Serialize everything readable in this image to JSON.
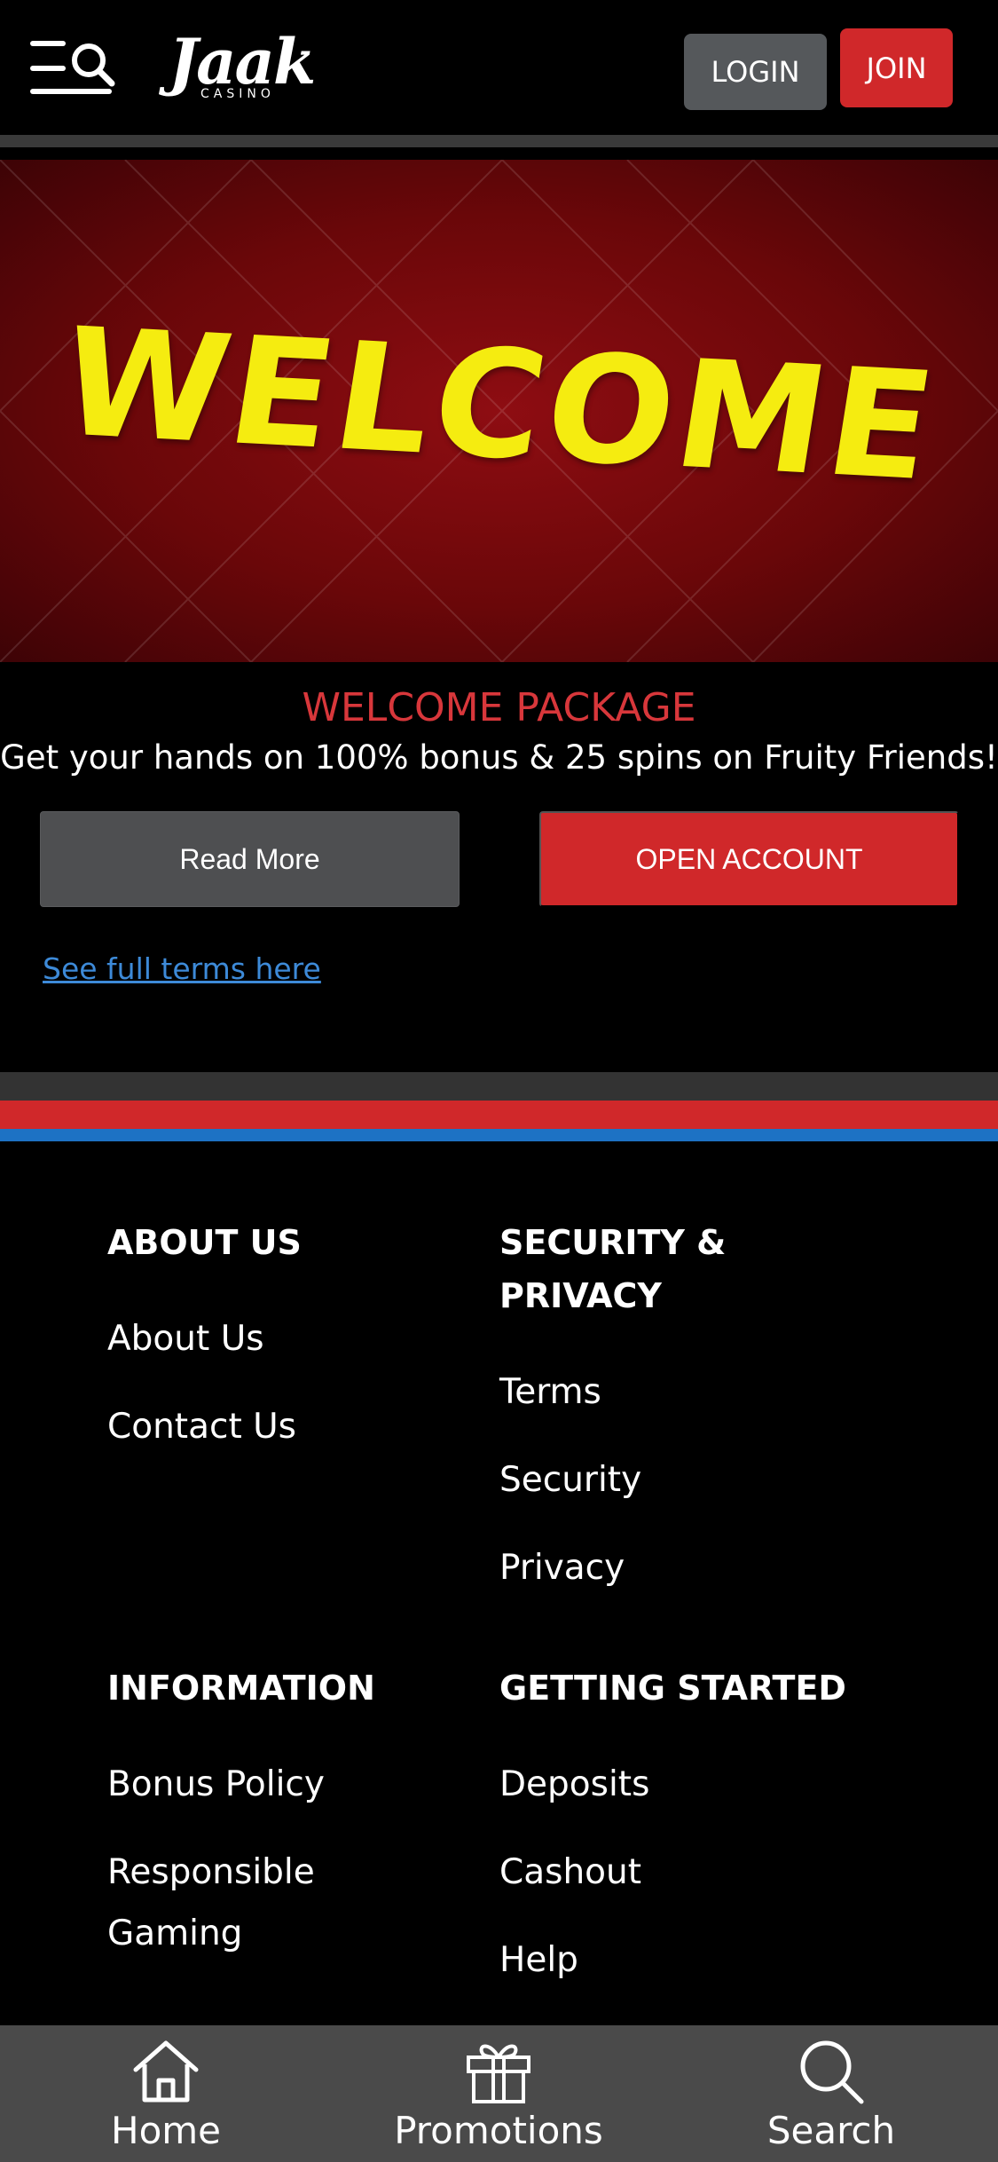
{
  "header": {
    "logo_text": "Jaak",
    "logo_subtext": "CASINO",
    "login_label": "LOGIN",
    "join_label": "JOIN"
  },
  "hero": {
    "title": "WELCOME"
  },
  "promo": {
    "title": "WELCOME PACKAGE",
    "text": "Get your hands on 100% bonus & 25 spins on Fruity Friends!",
    "read_more_label": "Read More",
    "open_account_label": "OPEN ACCOUNT",
    "terms_link": "See full terms here"
  },
  "footer": {
    "about": {
      "heading": "ABOUT US",
      "links": [
        "About Us",
        "Contact Us"
      ]
    },
    "security": {
      "heading_line1": "SECURITY &",
      "heading_line2": "PRIVACY",
      "links": [
        "Terms",
        "Security",
        "Privacy"
      ]
    },
    "information": {
      "heading": "INFORMATION",
      "links": [
        "Bonus Policy",
        "Responsible",
        "Gaming"
      ]
    },
    "getting_started": {
      "heading": "GETTING STARTED",
      "links": [
        "Deposits",
        "Cashout",
        "Help"
      ]
    }
  },
  "bottom_nav": {
    "items": [
      {
        "label": "Home",
        "icon": "home-icon"
      },
      {
        "label": "Promotions",
        "icon": "gift-icon"
      },
      {
        "label": "Search",
        "icon": "search-icon"
      }
    ]
  },
  "colors": {
    "accent_red": "#d0282a",
    "accent_blue": "#1d72c4",
    "hero_yellow": "#f5ec10",
    "link_blue": "#3d8ad8"
  }
}
